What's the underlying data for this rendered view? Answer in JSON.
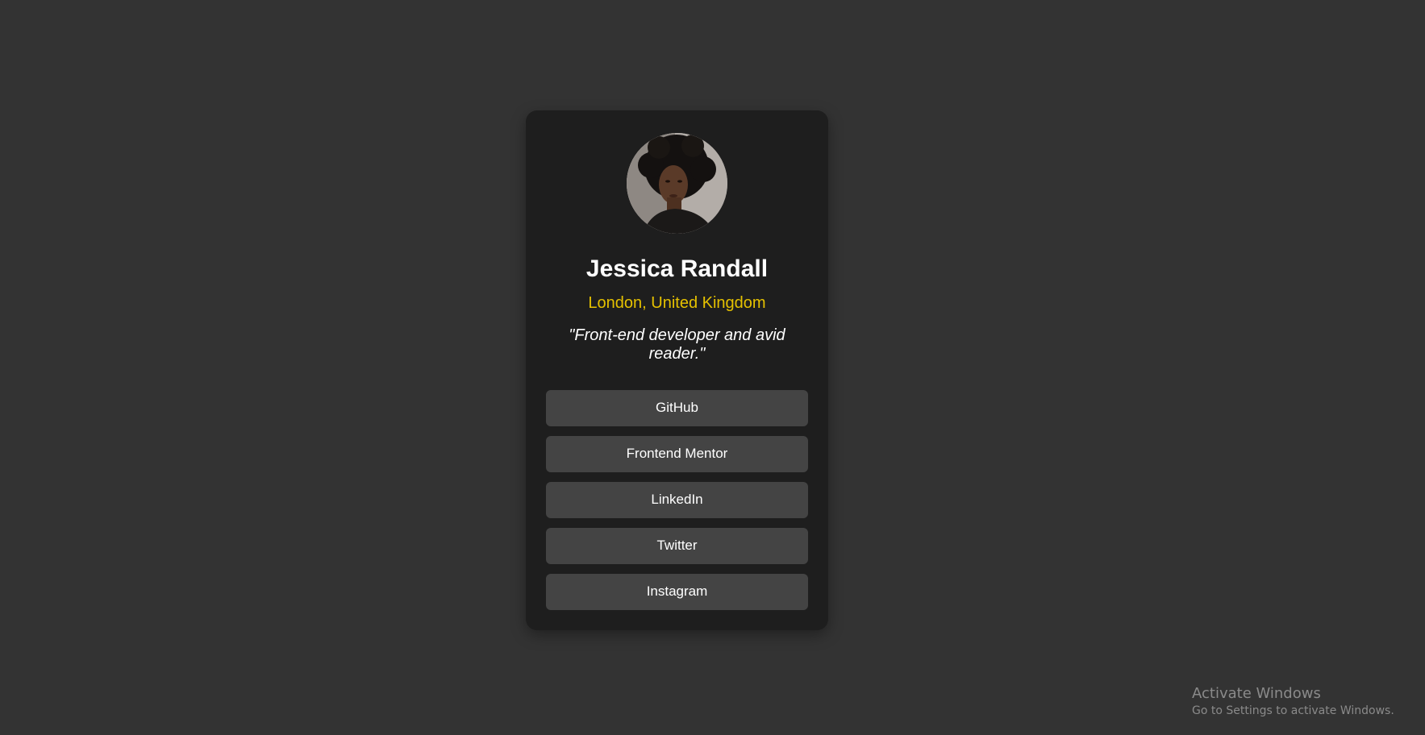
{
  "profile": {
    "avatar_alt": "Jessica Randall",
    "name": "Jessica Randall",
    "location": "London, United Kingdom",
    "bio": "\"Front-end developer and avid reader.\""
  },
  "links": [
    {
      "label": "GitHub"
    },
    {
      "label": "Frontend Mentor"
    },
    {
      "label": "LinkedIn"
    },
    {
      "label": "Twitter"
    },
    {
      "label": "Instagram"
    }
  ],
  "colors": {
    "page_background": "#333333",
    "card_background": "#1e1e1e",
    "accent": "#e5c100",
    "button_background": "#444444"
  },
  "watermark": {
    "title": "Activate Windows",
    "subtitle": "Go to Settings to activate Windows."
  }
}
